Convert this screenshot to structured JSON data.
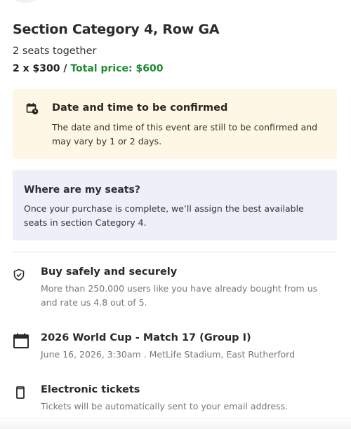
{
  "listing": {
    "title": "Section Category 4, Row GA",
    "seats": "2 seats together",
    "price_breakdown": "2 x $300 /",
    "total_price": "Total price: $600"
  },
  "date_notice": {
    "icon": "calendar-clock-icon",
    "title": "Date and time to be confirmed",
    "text": "The date and time of this event are still to be confirmed and may vary by 1 or 2 days."
  },
  "seats_notice": {
    "title": "Where are my seats?",
    "text": "Once your purchase is complete, we’ll assign the best available seats in section Category 4."
  },
  "features": [
    {
      "icon": "shield-check-icon",
      "title": "Buy safely and securely",
      "text": "More than 250.000 users like you have already bought from us and rate us 4.8 out of 5."
    },
    {
      "icon": "calendar-icon",
      "title": "2026 World Cup - Match 17 (Group I)",
      "text": "June 16, 2026, 3:30am . MetLife Stadium, East Rutherford"
    },
    {
      "icon": "phone-icon",
      "title": "Electronic tickets",
      "text": "Tickets will be automatically sent to your email address."
    }
  ],
  "colors": {
    "total_price": "#1f8a32",
    "warn_bg": "#fff7e6",
    "info_bg": "#edf0f8"
  }
}
